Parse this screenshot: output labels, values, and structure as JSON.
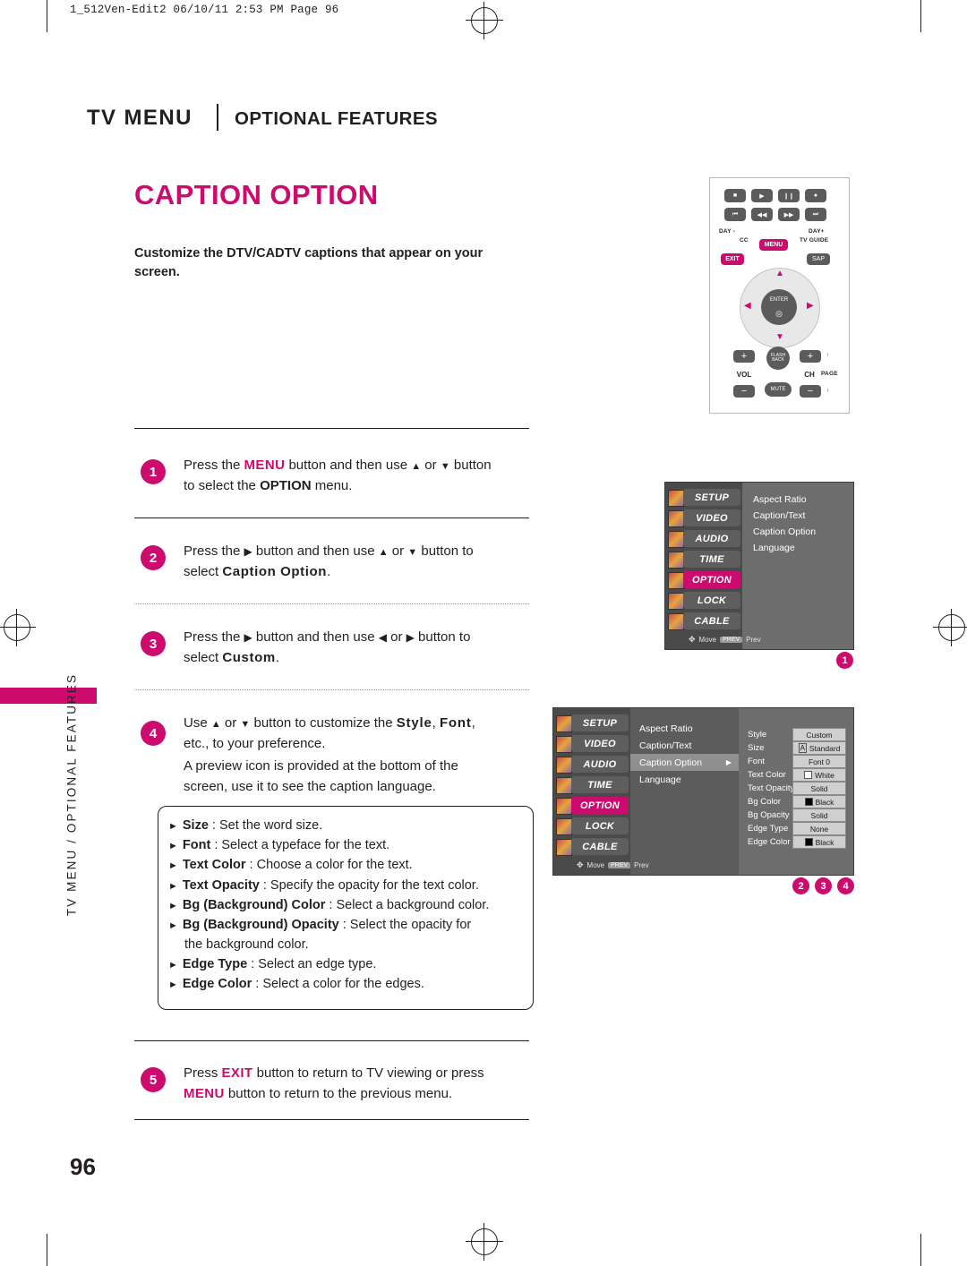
{
  "document": {
    "filestamp": "1_512Ven-Edit2  06/10/11  2:53 PM  Page 96",
    "chapter_title": "TV MENU",
    "chapter_subtitle": "OPTIONAL FEATURES",
    "page_title": "CAPTION OPTION",
    "intro": "Customize the DTV/CADTV captions that appear on your screen.",
    "side_tab": "TV MENU / OPTIONAL FEATURES",
    "page_number": "96"
  },
  "steps": [
    {
      "number": "1",
      "line1_a": "Press the ",
      "line1_key": "MENU",
      "line1_b": " button and then use ",
      "line1_c": " or ",
      "line1_d": " button",
      "line2_a": "to select the ",
      "line2_b": "OPTION",
      "line2_c": " menu."
    },
    {
      "number": "2",
      "line1_a": "Press the ",
      "line1_b": " button and then use ",
      "line1_c": " or ",
      "line1_d": " button to",
      "line2_a": "select ",
      "line2_b": "Caption Option",
      "line2_c": "."
    },
    {
      "number": "3",
      "line1_a": "Press the ",
      "line1_b": " button and then use ",
      "line1_c": " or ",
      "line1_d": " button to",
      "line2_a": "select ",
      "line2_b": "Custom",
      "line2_c": "."
    },
    {
      "number": "4",
      "line1_a": "Use ",
      "line1_b": " or ",
      "line1_c": " button to customize the ",
      "line1_d": "Style",
      "line1_e": ", ",
      "line1_f": "Font",
      "line1_g": ",",
      "line2": "etc., to your preference.",
      "line3": "A preview icon is provided at the bottom of the",
      "line4": "screen, use it to see the caption language."
    },
    {
      "number": "5",
      "line1_a": "Press ",
      "line1_key": "EXIT",
      "line1_b": " button to return to TV viewing or press",
      "line2_key": "MENU",
      "line2_b": " button to return to the previous menu."
    }
  ],
  "bullets": [
    {
      "term": "Size",
      "desc": " : Set the word size."
    },
    {
      "term": "Font",
      "desc": " : Select a typeface for the text."
    },
    {
      "term": "Text Color",
      "desc": " : Choose a color for the text."
    },
    {
      "term": "Text Opacity",
      "desc": " : Specify the opacity for the text color."
    },
    {
      "term": "Bg (Background) Color",
      "desc": " : Select a background color."
    },
    {
      "term": "Bg (Background) Opacity",
      "desc": " : Select the opacity for",
      "desc2": "the background color."
    },
    {
      "term": "Edge Type",
      "desc": " : Select an edge type."
    },
    {
      "term": "Edge Color",
      "desc": " : Select a color for the edges."
    }
  ],
  "remote": {
    "labels": {
      "day_minus": "DAY -",
      "day_plus": "DAY+",
      "cc": "CC",
      "menu": "MENU",
      "tvguide": "TV GUIDE",
      "exit": "EXIT",
      "sap": "SAP",
      "enter": "ENTER",
      "vol": "VOL",
      "ch": "CH",
      "page": "PAGE",
      "flashback": "FLASH BACK",
      "mute": "MUTE",
      "plus": "+",
      "minus": "−"
    }
  },
  "osd1": {
    "menu_items": [
      "SETUP",
      "VIDEO",
      "AUDIO",
      "TIME",
      "OPTION",
      "LOCK",
      "CABLE"
    ],
    "selected_menu": "OPTION",
    "right_items": [
      "Aspect Ratio",
      "Caption/Text",
      "Caption Option",
      "Language"
    ],
    "hint_move": "Move",
    "hint_prev_key": "PREV",
    "hint_prev": "Prev",
    "callout": "1"
  },
  "osd2": {
    "menu_items": [
      "SETUP",
      "VIDEO",
      "AUDIO",
      "TIME",
      "OPTION",
      "LOCK",
      "CABLE"
    ],
    "selected_menu": "OPTION",
    "mid_items": [
      "Aspect Ratio",
      "Caption/Text",
      "Caption Option",
      "Language"
    ],
    "mid_selected": "Caption Option",
    "settings": [
      {
        "label": "Style",
        "value": "Custom",
        "swatch": ""
      },
      {
        "label": "Size",
        "value": "Standard",
        "swatch": ""
      },
      {
        "label": "Font",
        "value": "Font  0",
        "swatch": ""
      },
      {
        "label": "Text Color",
        "value": "White",
        "swatch": "#ffffff"
      },
      {
        "label": "Text Opacity",
        "value": "Solid",
        "swatch": ""
      },
      {
        "label": "Bg Color",
        "value": "Black",
        "swatch": "#000000"
      },
      {
        "label": "Bg Opacity",
        "value": "Solid",
        "swatch": ""
      },
      {
        "label": "Edge Type",
        "value": "None",
        "swatch": ""
      },
      {
        "label": "Edge Color",
        "value": "Black",
        "swatch": "#000000"
      }
    ],
    "hint_move": "Move",
    "hint_prev_key": "PREV",
    "hint_prev": "Prev",
    "callouts": [
      "2",
      "3",
      "4"
    ]
  },
  "colors": {
    "accent": "#cd0a6e",
    "text": "#231f20",
    "osd_bg": "#6d6d6d",
    "osd_sidebar": "#4a4a4a"
  }
}
